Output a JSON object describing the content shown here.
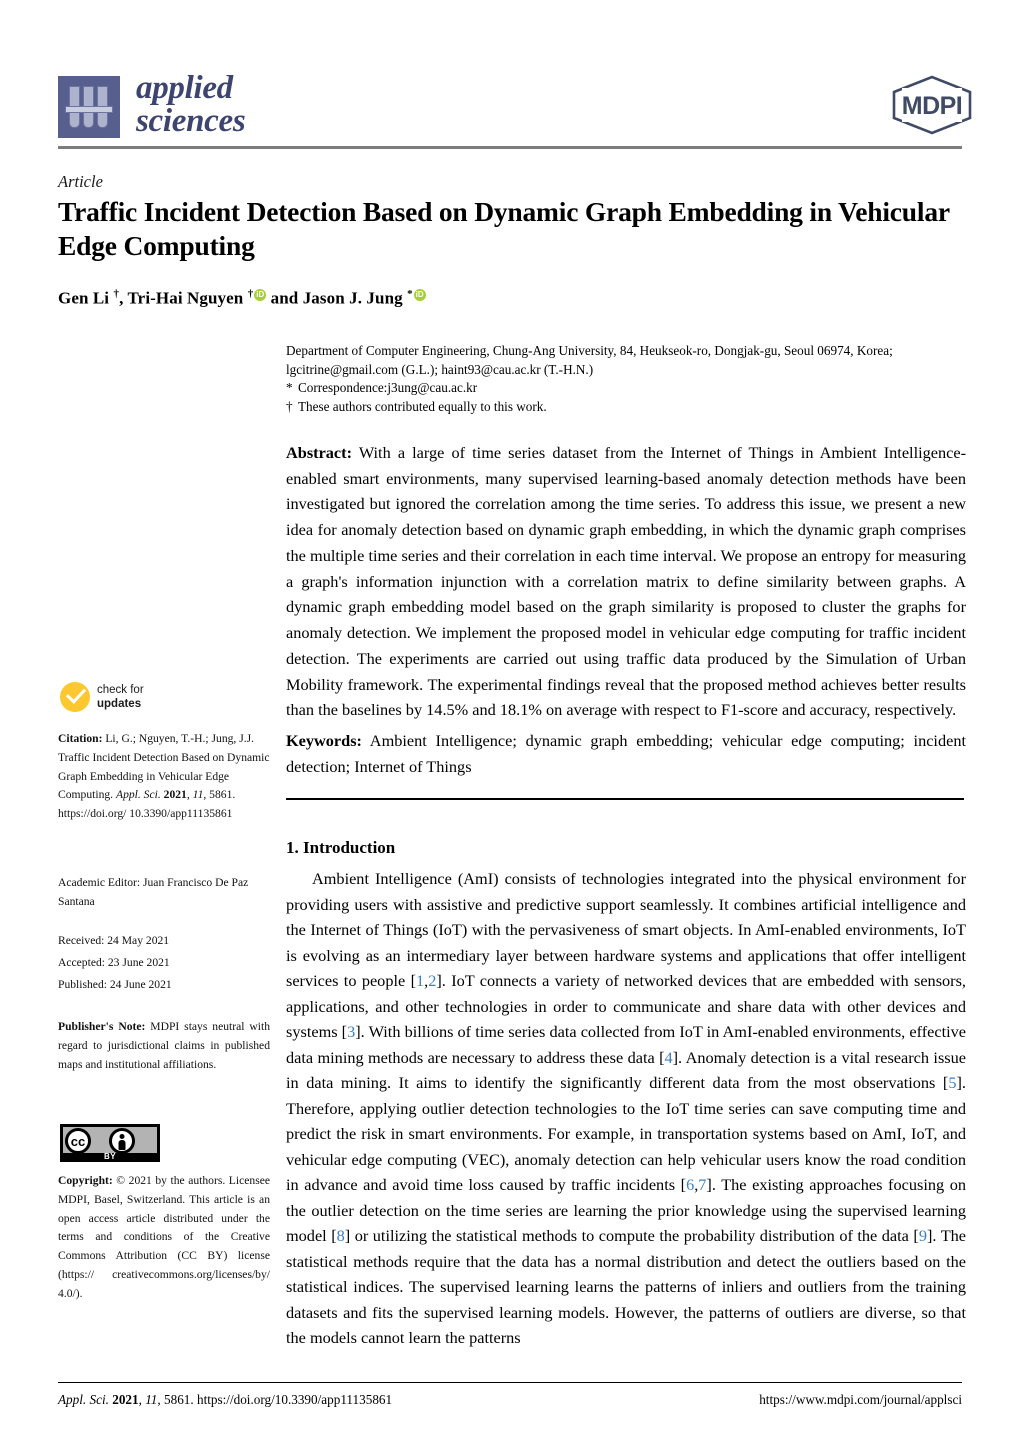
{
  "journal": {
    "name_line1": "applied",
    "name_line2": "sciences",
    "publisher_logo_text": "MDPI"
  },
  "article": {
    "kind": "Article",
    "title": "Traffic Incident Detection Based on Dynamic Graph Embedding in Vehicular Edge Computing",
    "authors_html": "Gen Li <sup class=\"sup\">†</sup>, Tri-Hai Nguyen <sup class=\"sup\">†</sup><span class=\"orcid\" data-name=\"orcid-icon\">iD</span> and Jason J. Jung <sup class=\"sup\">*</sup><span class=\"orcid\" data-name=\"orcid-icon\">iD</span>",
    "affiliation_line1": "Department of Computer Engineering, Chung-Ang University, 84, Heukseok-ro, Dongjak-gu, Seoul 06974, Korea;",
    "affiliation_line2": "lgcitrine@gmail.com (G.L.); haint93@cau.ac.kr (T.-H.N.)",
    "correspondence_marker": "*",
    "correspondence": "Correspondence:j3ung@cau.ac.kr",
    "equal_contrib_marker": "†",
    "equal_contrib": "These authors contributed equally to this work."
  },
  "abstract": {
    "label": "Abstract:",
    "text": " With a large of time series dataset from the Internet of Things in Ambient Intelligence-enabled smart environments, many supervised learning-based anomaly detection methods have been investigated but ignored the correlation among the time series.  To address this issue, we present a new idea for anomaly detection based on dynamic graph embedding, in which the dynamic graph comprises the multiple time series and their correlation in each time interval. We propose an entropy for measuring a graph's information injunction with a correlation matrix to define similarity between graphs.  A dynamic graph embedding model based on the graph similarity is proposed to cluster the graphs for anomaly detection. We implement the proposed model in vehicular edge computing for traffic incident detection. The experiments are carried out using traffic data produced by the Simulation of Urban Mobility framework. The experimental findings reveal that the proposed method achieves better results than the baselines by 14.5% and 18.1% on average with respect to F1-score and accuracy, respectively."
  },
  "keywords": {
    "label": "Keywords:",
    "text": " Ambient Intelligence; dynamic graph embedding; vehicular edge computing; incident detection; Internet of Things"
  },
  "section": {
    "heading": "1. Introduction",
    "paragraph_html": "Ambient Intelligence (AmI) consists of technologies integrated into the physical environment for providing users with assistive and predictive support seamlessly. It combines artificial intelligence and the Internet of Things (IoT) with the pervasiveness of smart objects. In AmI-enabled environments, IoT is evolving as an intermediary layer between hardware systems and applications that offer intelligent services to people [<span class=\"ref\">1</span>,<span class=\"ref\">2</span>].  IoT connects a variety of networked devices that are embedded with sensors, applications, and other technologies in order to communicate and share data with other devices and systems [<span class=\"ref\">3</span>]. With billions of time series data collected from IoT in AmI-enabled environments, effective data mining methods are necessary to address these data [<span class=\"ref\">4</span>]. Anomaly detection is a vital research issue in data mining. It aims to identify the significantly different data from the most observations [<span class=\"ref\">5</span>]. Therefore, applying outlier detection technologies to the IoT time series can save computing time and predict the risk in smart environments.  For example, in transportation systems based on AmI, IoT, and vehicular edge computing (VEC), anomaly detection can help vehicular users know the road condition in advance and avoid time loss caused by traffic incidents [<span class=\"ref\">6</span>,<span class=\"ref\">7</span>]. The existing approaches focusing on the outlier detection on the time series are learning the prior knowledge using the supervised learning model [<span class=\"ref\">8</span>] or utilizing the statistical methods to compute the probability distribution of the data [<span class=\"ref\">9</span>]. The statistical methods require that the data has a normal distribution and detect the outliers based on the statistical indices. The supervised learning learns the patterns of inliers and outliers from the training datasets and fits the supervised learning models. However, the patterns of outliers are diverse, so that the models cannot learn the patterns"
  },
  "sidebar": {
    "check_updates_line1": "check for",
    "check_updates_line2": "updates",
    "citation_html": "<b>Citation:</b>  Li, G.; Nguyen, T.-H.; Jung, J.J. Traffic Incident Detection Based on Dynamic Graph Embedding in Vehicular Edge Computing. <i>Appl. Sci.</i> <b>2021</b>, <i>11</i>, 5861.  https://doi.org/ 10.3390/app11135861",
    "academic_editor": "Academic Editor: Juan Francisco De Paz Santana",
    "received": "Received: 24 May 2021",
    "accepted": "Accepted: 23 June 2021",
    "published": "Published: 24 June 2021",
    "publishers_note_html": "<b>Publisher's Note:</b> MDPI stays neutral with regard to jurisdictional claims in published maps and institutional affiliations.",
    "cc_badge": {
      "cc_text": "cc",
      "by_text": "BY"
    },
    "copyright_html": "<b>Copyright:</b> © 2021 by the authors. Licensee MDPI, Basel, Switzerland. This article is an open access article distributed under the terms and conditions of the Creative Commons Attribution (CC BY) license (https:// creativecommons.org/licenses/by/ 4.0/)."
  },
  "footer": {
    "left_html": "<i>Appl. Sci.</i> <b>2021</b>, <i>11</i>, 5861. https://doi.org/10.3390/app11135861",
    "right": "https://www.mdpi.com/journal/applsci"
  },
  "colors": {
    "journal_blue": "#3d4470",
    "mdpi_navy": "#3f4a66",
    "orcid_green": "#a6ce39",
    "check_yellow": "#fdc82f",
    "reference_blue": "#3b7fc4",
    "header_rule_gray": "#7c7c7c"
  }
}
